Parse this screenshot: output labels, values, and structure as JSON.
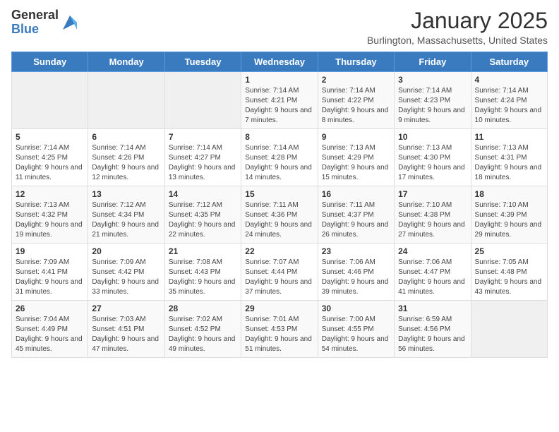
{
  "header": {
    "logo_general": "General",
    "logo_blue": "Blue",
    "month_year": "January 2025",
    "location": "Burlington, Massachusetts, United States"
  },
  "days_of_week": [
    "Sunday",
    "Monday",
    "Tuesday",
    "Wednesday",
    "Thursday",
    "Friday",
    "Saturday"
  ],
  "weeks": [
    [
      {
        "day": "",
        "info": ""
      },
      {
        "day": "",
        "info": ""
      },
      {
        "day": "",
        "info": ""
      },
      {
        "day": "1",
        "info": "Sunrise: 7:14 AM\nSunset: 4:21 PM\nDaylight: 9 hours and 7 minutes."
      },
      {
        "day": "2",
        "info": "Sunrise: 7:14 AM\nSunset: 4:22 PM\nDaylight: 9 hours and 8 minutes."
      },
      {
        "day": "3",
        "info": "Sunrise: 7:14 AM\nSunset: 4:23 PM\nDaylight: 9 hours and 9 minutes."
      },
      {
        "day": "4",
        "info": "Sunrise: 7:14 AM\nSunset: 4:24 PM\nDaylight: 9 hours and 10 minutes."
      }
    ],
    [
      {
        "day": "5",
        "info": "Sunrise: 7:14 AM\nSunset: 4:25 PM\nDaylight: 9 hours and 11 minutes."
      },
      {
        "day": "6",
        "info": "Sunrise: 7:14 AM\nSunset: 4:26 PM\nDaylight: 9 hours and 12 minutes."
      },
      {
        "day": "7",
        "info": "Sunrise: 7:14 AM\nSunset: 4:27 PM\nDaylight: 9 hours and 13 minutes."
      },
      {
        "day": "8",
        "info": "Sunrise: 7:14 AM\nSunset: 4:28 PM\nDaylight: 9 hours and 14 minutes."
      },
      {
        "day": "9",
        "info": "Sunrise: 7:13 AM\nSunset: 4:29 PM\nDaylight: 9 hours and 15 minutes."
      },
      {
        "day": "10",
        "info": "Sunrise: 7:13 AM\nSunset: 4:30 PM\nDaylight: 9 hours and 17 minutes."
      },
      {
        "day": "11",
        "info": "Sunrise: 7:13 AM\nSunset: 4:31 PM\nDaylight: 9 hours and 18 minutes."
      }
    ],
    [
      {
        "day": "12",
        "info": "Sunrise: 7:13 AM\nSunset: 4:32 PM\nDaylight: 9 hours and 19 minutes."
      },
      {
        "day": "13",
        "info": "Sunrise: 7:12 AM\nSunset: 4:34 PM\nDaylight: 9 hours and 21 minutes."
      },
      {
        "day": "14",
        "info": "Sunrise: 7:12 AM\nSunset: 4:35 PM\nDaylight: 9 hours and 22 minutes."
      },
      {
        "day": "15",
        "info": "Sunrise: 7:11 AM\nSunset: 4:36 PM\nDaylight: 9 hours and 24 minutes."
      },
      {
        "day": "16",
        "info": "Sunrise: 7:11 AM\nSunset: 4:37 PM\nDaylight: 9 hours and 26 minutes."
      },
      {
        "day": "17",
        "info": "Sunrise: 7:10 AM\nSunset: 4:38 PM\nDaylight: 9 hours and 27 minutes."
      },
      {
        "day": "18",
        "info": "Sunrise: 7:10 AM\nSunset: 4:39 PM\nDaylight: 9 hours and 29 minutes."
      }
    ],
    [
      {
        "day": "19",
        "info": "Sunrise: 7:09 AM\nSunset: 4:41 PM\nDaylight: 9 hours and 31 minutes."
      },
      {
        "day": "20",
        "info": "Sunrise: 7:09 AM\nSunset: 4:42 PM\nDaylight: 9 hours and 33 minutes."
      },
      {
        "day": "21",
        "info": "Sunrise: 7:08 AM\nSunset: 4:43 PM\nDaylight: 9 hours and 35 minutes."
      },
      {
        "day": "22",
        "info": "Sunrise: 7:07 AM\nSunset: 4:44 PM\nDaylight: 9 hours and 37 minutes."
      },
      {
        "day": "23",
        "info": "Sunrise: 7:06 AM\nSunset: 4:46 PM\nDaylight: 9 hours and 39 minutes."
      },
      {
        "day": "24",
        "info": "Sunrise: 7:06 AM\nSunset: 4:47 PM\nDaylight: 9 hours and 41 minutes."
      },
      {
        "day": "25",
        "info": "Sunrise: 7:05 AM\nSunset: 4:48 PM\nDaylight: 9 hours and 43 minutes."
      }
    ],
    [
      {
        "day": "26",
        "info": "Sunrise: 7:04 AM\nSunset: 4:49 PM\nDaylight: 9 hours and 45 minutes."
      },
      {
        "day": "27",
        "info": "Sunrise: 7:03 AM\nSunset: 4:51 PM\nDaylight: 9 hours and 47 minutes."
      },
      {
        "day": "28",
        "info": "Sunrise: 7:02 AM\nSunset: 4:52 PM\nDaylight: 9 hours and 49 minutes."
      },
      {
        "day": "29",
        "info": "Sunrise: 7:01 AM\nSunset: 4:53 PM\nDaylight: 9 hours and 51 minutes."
      },
      {
        "day": "30",
        "info": "Sunrise: 7:00 AM\nSunset: 4:55 PM\nDaylight: 9 hours and 54 minutes."
      },
      {
        "day": "31",
        "info": "Sunrise: 6:59 AM\nSunset: 4:56 PM\nDaylight: 9 hours and 56 minutes."
      },
      {
        "day": "",
        "info": ""
      }
    ]
  ]
}
